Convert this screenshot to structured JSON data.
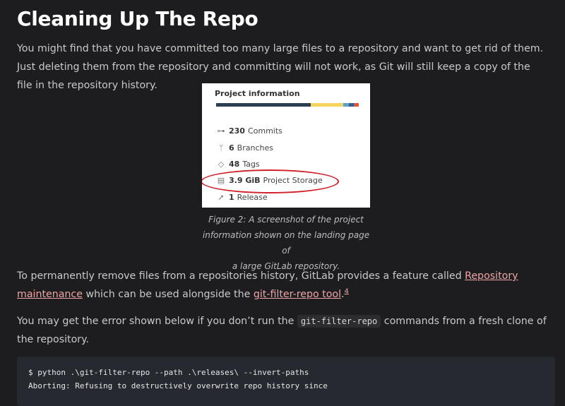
{
  "heading": "Cleaning Up The Repo",
  "para1": "You might find that you have committed too many large files to a repository and want to get rid of them. Just deleting them from the repository and committing will not work, as Git will still keep a copy of the file in the repository history.",
  "figure": {
    "title": "Project information",
    "bar_colors": [
      "#2c3e50",
      "#f4d35e",
      "#5ba3c7",
      "#3b5f8a",
      "#e4572e"
    ],
    "rows": [
      {
        "icon": "commit-icon",
        "glyph": "⊶",
        "value": "230",
        "label": "Commits"
      },
      {
        "icon": "branch-icon",
        "glyph": "ᛘ",
        "value": "6",
        "label": "Branches"
      },
      {
        "icon": "tag-icon",
        "glyph": "◇",
        "value": "48",
        "label": "Tags"
      },
      {
        "icon": "storage-icon",
        "glyph": "▤",
        "value": "3.9 GiB",
        "label": "Project Storage"
      },
      {
        "icon": "release-icon",
        "glyph": "➚",
        "value": "1",
        "label": "Release"
      }
    ]
  },
  "caption": {
    "line1": "Figure 2: A screenshot of the project",
    "line2": "information shown on the landing page of",
    "line3": "a large GitLab repository."
  },
  "para2": {
    "before": "To permanently remove files from a repositories history, GitLab provides a feature called ",
    "link1": "Repository maintenance",
    "middle": " which can be used alongside the ",
    "link2": "git-filter-repo tool",
    "dot": ".",
    "footnote": "4"
  },
  "para3": {
    "before": "You may get the error shown below if you don’t run the ",
    "code": "git-filter-repo",
    "after": " commands from a fresh clone of the repository."
  },
  "code": {
    "line1": "$ python .\\git-filter-repo --path .\\releases\\ --invert-paths",
    "line2": "Aborting: Refusing to destructively overwrite repo history since"
  }
}
